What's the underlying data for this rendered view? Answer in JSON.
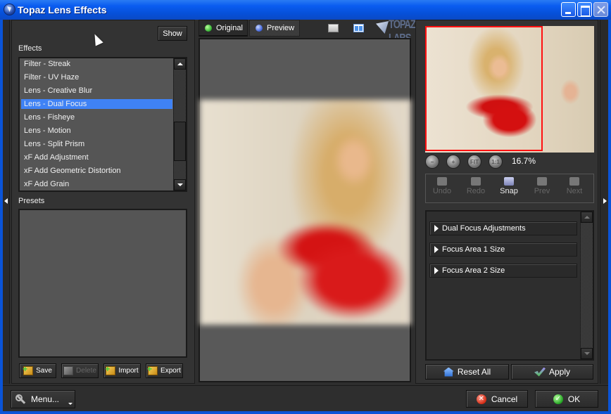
{
  "window": {
    "title": "Topaz Lens Effects",
    "controls": [
      "minimize",
      "maximize",
      "close"
    ]
  },
  "left_panel": {
    "show_button": "Show",
    "effects_label": "Effects",
    "effects": [
      {
        "label": "Filter - Streak",
        "selected": false
      },
      {
        "label": "Filter - UV Haze",
        "selected": false
      },
      {
        "label": "Lens - Creative Blur",
        "selected": false
      },
      {
        "label": "Lens - Dual Focus",
        "selected": true
      },
      {
        "label": "Lens - Fisheye",
        "selected": false
      },
      {
        "label": "Lens - Motion",
        "selected": false
      },
      {
        "label": "Lens - Split Prism",
        "selected": false
      },
      {
        "label": "xF Add Adjustment",
        "selected": false
      },
      {
        "label": "xF Add Geometric Distortion",
        "selected": false
      },
      {
        "label": "xF Add Grain",
        "selected": false
      }
    ],
    "presets_label": "Presets",
    "preset_buttons": [
      {
        "label": "Save",
        "enabled": true
      },
      {
        "label": "Delete",
        "enabled": false
      },
      {
        "label": "Import",
        "enabled": true
      },
      {
        "label": "Export",
        "enabled": true
      }
    ]
  },
  "center_panel": {
    "tabs": [
      {
        "label": "Original",
        "active": false
      },
      {
        "label": "Preview",
        "active": true
      }
    ],
    "view_icons": [
      "single-view-icon",
      "split-view-icon"
    ],
    "logo": "TOPAZ LABS"
  },
  "right_panel": {
    "zoom_buttons": [
      {
        "label": "−",
        "name": "zoom-out"
      },
      {
        "label": "+",
        "name": "zoom-in"
      },
      {
        "label": "FIT",
        "name": "zoom-fit"
      },
      {
        "label": "1:1",
        "name": "zoom-actual"
      }
    ],
    "zoom_level": "16.7%",
    "history": [
      {
        "label": "Undo",
        "enabled": false
      },
      {
        "label": "Redo",
        "enabled": false
      },
      {
        "label": "Snap",
        "enabled": true
      },
      {
        "label": "Prev",
        "enabled": false
      },
      {
        "label": "Next",
        "enabled": false
      }
    ],
    "sections": [
      {
        "label": "Dual Focus Adjustments"
      },
      {
        "label": "Focus Area 1 Size"
      },
      {
        "label": "Focus Area 2 Size"
      }
    ],
    "reset_label": "Reset All",
    "apply_label": "Apply"
  },
  "bottom_bar": {
    "menu_label": "Menu...",
    "cancel_label": "Cancel",
    "ok_label": "OK"
  },
  "colors": {
    "selection": "#3f82f5",
    "titlebar": "#0a5cf0",
    "thumbnail_frame": "#ff1010"
  }
}
